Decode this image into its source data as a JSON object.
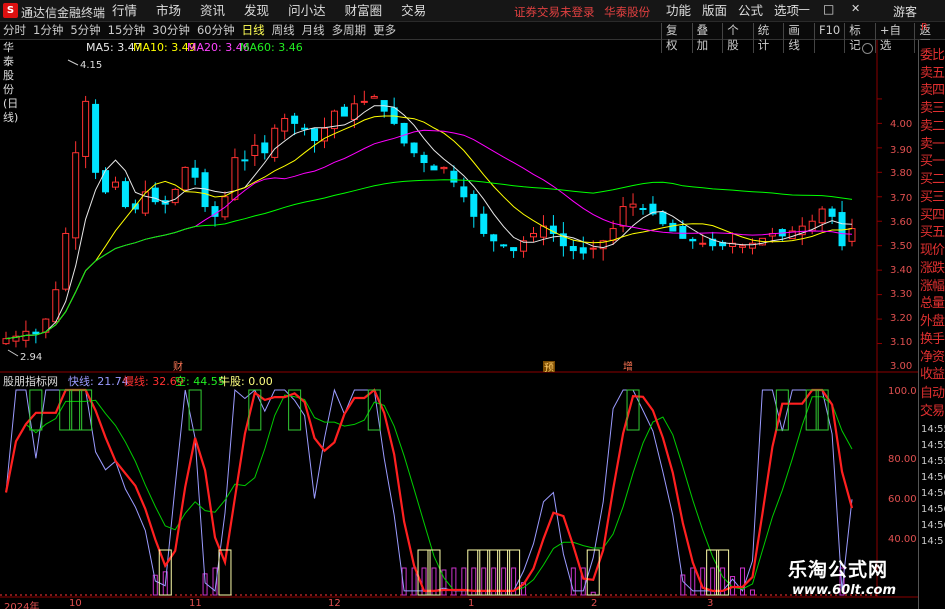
{
  "app": {
    "logo": "S",
    "title": "通达信金融终端"
  },
  "menu": [
    "行情",
    "市场",
    "资讯",
    "发现",
    "问小达",
    "财富圈",
    "交易"
  ],
  "menu_notice": [
    "证券交易未登录",
    "华泰股份"
  ],
  "menu_right": [
    "功能",
    "版面",
    "公式",
    "选项"
  ],
  "window_controls": [
    "—",
    "□",
    "✕"
  ],
  "guest": "游客",
  "periods": [
    "分时",
    "1分钟",
    "5分钟",
    "15分钟",
    "30分钟",
    "60分钟",
    "日线",
    "周线",
    "月线",
    "多周期",
    "更多"
  ],
  "active_period": "日线",
  "tools": [
    "复权",
    "叠加",
    "个股",
    "统计",
    "画线",
    "F10",
    "标记",
    "+自选",
    "返回"
  ],
  "main_header": {
    "name": "华泰股份(日线)",
    "ma5": "MA5: 3.47",
    "ma10": "MA10: 3.49",
    "ma20": "MA20: 3.46",
    "ma60": "MA60: 3.46"
  },
  "colors": {
    "up": "#ff3232",
    "down": "#00e5ff",
    "ma5": "#e8e8e8",
    "ma10": "#ffff00",
    "ma20": "#ff00ff",
    "ma60": "#00ff00",
    "fast": "#9b9bff",
    "slow": "#ff2020",
    "empty": "#00cc00",
    "bull": "#ffff80",
    "box_green": "#33cc33",
    "box_yellow": "#ffffaa"
  },
  "price_axis": [
    "4.00",
    "3.90",
    "3.80",
    "3.70",
    "3.60",
    "3.50",
    "3.40",
    "3.30",
    "3.20",
    "3.10",
    "3.00"
  ],
  "price_high_label": "4.15",
  "price_low_label": "2.94",
  "chart_markers": [
    "财",
    "预",
    "增"
  ],
  "sub_header": {
    "name": "股朋指标网",
    "fast": "快线: 21.74",
    "slow": "慢线: 32.69",
    "empty": "空: 44.55",
    "bull": "牛股: 0.00"
  },
  "sub_axis": [
    "100.0",
    "80.00",
    "60.00",
    "40.00"
  ],
  "right_panel": [
    "委比",
    "卖五",
    "卖四",
    "卖三",
    "卖二",
    "卖一",
    "买一",
    "买二",
    "买三",
    "买四",
    "买五",
    "现价",
    "涨跌",
    "涨幅",
    "总量",
    "外盘",
    "换手",
    "净资",
    "收益"
  ],
  "right_panel_lower": [
    "自动",
    "交易"
  ],
  "times": [
    "14:55",
    "14:55",
    "14:55",
    "14:56",
    "14:56",
    "14:56",
    "14:56",
    "14:5"
  ],
  "date_axis": [
    "2024年",
    "10",
    "11",
    "12",
    "1",
    "2",
    "3"
  ],
  "watermark": {
    "title": "乐淘公式网",
    "url": "www.60lt.com"
  },
  "chart_data": [
    {
      "type": "candlestick",
      "title": "华泰股份(日线)",
      "ylim": [
        2.9,
        4.2
      ],
      "x_periods": [
        "2024-09",
        "2024-10",
        "2024-11",
        "2024-12",
        "2025-01",
        "2025-02",
        "2025-03"
      ],
      "close_path": [
        3.02,
        3.03,
        3.05,
        3.04,
        3.1,
        3.22,
        3.45,
        3.78,
        3.99,
        3.7,
        3.62,
        3.66,
        3.56,
        3.55,
        3.62,
        3.58,
        3.57,
        3.63,
        3.72,
        3.68,
        3.56,
        3.52,
        3.6,
        3.76,
        3.75,
        3.81,
        3.78,
        3.88,
        3.92,
        3.9,
        3.88,
        3.83,
        3.88,
        3.95,
        3.93,
        3.98,
        3.99,
        4.01,
        3.95,
        3.9,
        3.82,
        3.78,
        3.74,
        3.71,
        3.72,
        3.66,
        3.6,
        3.52,
        3.45,
        3.42,
        3.4,
        3.38,
        3.42,
        3.45,
        3.48,
        3.45,
        3.4,
        3.38,
        3.37,
        3.39,
        3.42,
        3.47,
        3.56,
        3.57,
        3.55,
        3.53,
        3.49,
        3.46,
        3.43,
        3.42,
        3.41,
        3.4,
        3.4,
        3.41,
        3.4,
        3.41,
        3.43,
        3.45,
        3.44,
        3.46,
        3.48,
        3.5,
        3.55,
        3.52,
        3.4,
        3.47
      ],
      "series": [
        {
          "name": "MA5",
          "last": 3.47
        },
        {
          "name": "MA10",
          "last": 3.49
        },
        {
          "name": "MA20",
          "last": 3.46
        },
        {
          "name": "MA60",
          "last": 3.46
        }
      ],
      "high_marker": 4.15,
      "low_marker": 2.94
    },
    {
      "type": "line",
      "title": "股朋指标网",
      "ylim": [
        0,
        100
      ],
      "series": [
        {
          "name": "快线",
          "last": 21.74
        },
        {
          "name": "慢线",
          "last": 32.69
        },
        {
          "name": "空",
          "last": 44.55
        },
        {
          "name": "牛股",
          "last": 0.0
        }
      ],
      "top_signal_count": 7,
      "bottom_signal_count": 7
    }
  ]
}
